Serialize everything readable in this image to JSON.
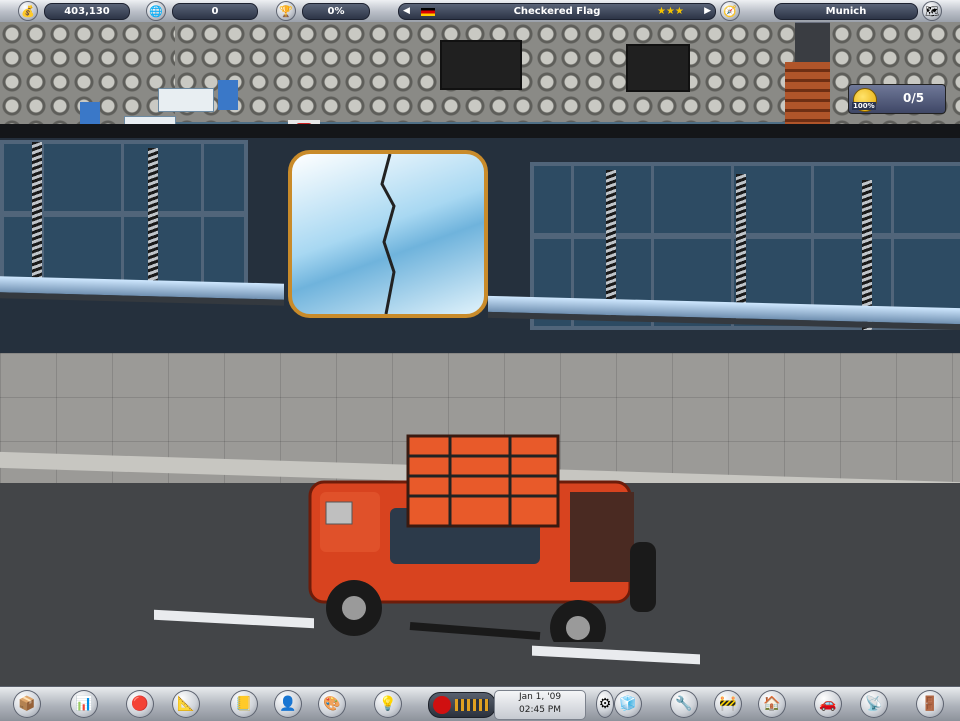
{
  "hud": {
    "money": "403,130",
    "score": "0",
    "percent": "0%",
    "location_name": "Checkered Flag",
    "city": "Munich",
    "stars": "★★★"
  },
  "objective": {
    "progress": "0/5",
    "satisfaction": "100%"
  },
  "clock": {
    "date": "Jan 1, '09",
    "time": "02:45 PM"
  },
  "colors": {
    "hud_pill": "#2c3446",
    "door_frame": "#c98b2a",
    "car": "#d8431f",
    "road": "#434548"
  },
  "icons": {
    "top": [
      "coin-icon",
      "globe-icon",
      "trophy-icon",
      "flag-icon",
      "compass-icon",
      "map-icon"
    ],
    "toolbar": [
      "crate-icon",
      "bar-chart-icon",
      "mail-icon",
      "blueprint-icon",
      "notebook-icon",
      "person-icon",
      "palette-icon",
      "lightbulb-icon",
      "record-icon",
      "cube-icon",
      "wrench-icon",
      "barrier-icon",
      "house-up-icon",
      "car-icon",
      "radar-icon",
      "exit-icon"
    ]
  }
}
